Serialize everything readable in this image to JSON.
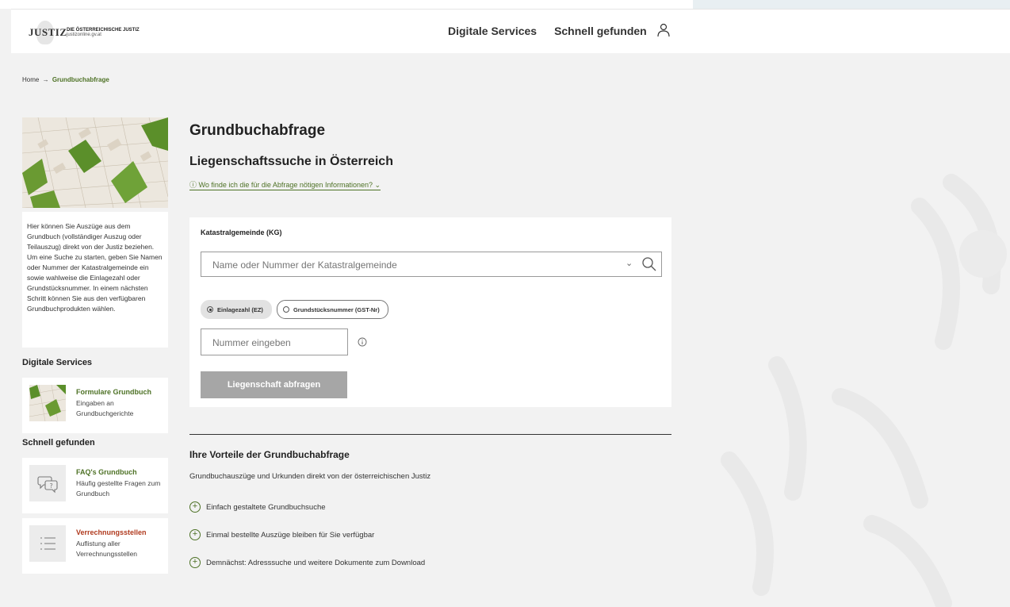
{
  "header": {
    "logo_word": "JUSTIZ",
    "logo_line1": "DIE ÖSTERREICHISCHE JUSTIZ",
    "logo_line2": "justizonline.gv.at",
    "nav": [
      "Digitale Services",
      "Schnell gefunden"
    ]
  },
  "breadcrumb": {
    "home": "Home",
    "arrow": "→",
    "current": "Grundbuchabfrage"
  },
  "sidebar": {
    "intro": "Hier können Sie Auszüge aus dem Grundbuch (vollständiger Auszug oder Teilauszug) direkt von der Justiz beziehen. Um eine Suche zu starten, geben Sie Namen oder Nummer der Katastralgemeinde ein sowie wahlweise die Einlagezahl oder Grundstücksnummer. In einem nächsten Schritt können Sie aus den verfügbaren Grundbuchprodukten wählen.",
    "digital_heading": "Digitale Services",
    "digital_cards": [
      {
        "title": "Formulare Grundbuch",
        "desc": "Eingaben an Grundbuchgerichte",
        "icon": "map-thumbnail"
      }
    ],
    "quick_heading": "Schnell gefunden",
    "quick_cards": [
      {
        "title": "FAQ's Grundbuch",
        "desc": "Häufig gestellte Fragen zum Grundbuch",
        "icon": "faq-icon",
        "color": "#4e7226"
      },
      {
        "title": "Verrechnungsstellen",
        "desc": "Auflistung aller Verrechnungsstellen",
        "icon": "list-icon",
        "color": "#b03a1e"
      }
    ]
  },
  "main": {
    "title": "Grundbuchabfrage",
    "subtitle": "Liegenschaftssuche in Österreich",
    "info_link": "ⓘ Wo finde ich die für die Abfrage nötigen Informationen? ⌄",
    "form": {
      "kg_label": "Katastralgemeinde (KG)",
      "kg_placeholder": "Name oder Nummer der Katastralgemeinde",
      "radio_options": [
        "Einlagezahl (EZ)",
        "Grundstücksnummer (GST-Nr)"
      ],
      "radio_selected": 0,
      "number_placeholder": "Nummer eingeben",
      "submit_label": "Liegenschaft abfragen"
    },
    "advantages": {
      "heading": "Ihre Vorteile der Grundbuchabfrage",
      "subheading": "Grundbuchauszüge und Urkunden direkt von der österreichischen Justiz",
      "items": [
        "Einfach gestaltete Grundbuchsuche",
        "Einmal bestellte Auszüge bleiben für Sie verfügbar",
        "Demnächst: Adresssuche und weitere Dokumente zum Download"
      ]
    }
  },
  "colors": {
    "accent": "#4e7226",
    "alert": "#b03a1e",
    "button_disabled": "#a6a6a6",
    "page_bg": "#f2f2f2"
  }
}
